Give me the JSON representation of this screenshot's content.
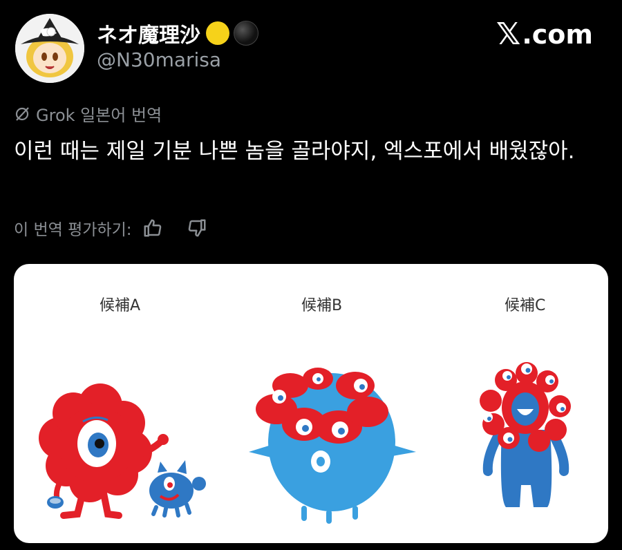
{
  "author": {
    "display_name": "ネオ魔理沙",
    "handle": "@N30marisa",
    "status_dots": [
      {
        "name": "yellow-dot",
        "color": "#f6d21a"
      },
      {
        "name": "black-dot",
        "color": "#111111"
      }
    ]
  },
  "brand": {
    "label": ".com"
  },
  "translation": {
    "label": "Grok 일본어 번역",
    "text": "이런 때는 제일 기분 나쁜 놈을 골라야지, 엑스포에서 배웠잖아.",
    "rate_prompt": "이 번역 평가하기:"
  },
  "media": {
    "candidates": [
      {
        "label": "候補A"
      },
      {
        "label": "候補B"
      },
      {
        "label": "候補C"
      }
    ]
  },
  "colors": {
    "mascot_red": "#e32028",
    "mascot_blue": "#2f78c4",
    "mascot_lightblue": "#3aa0e0"
  }
}
